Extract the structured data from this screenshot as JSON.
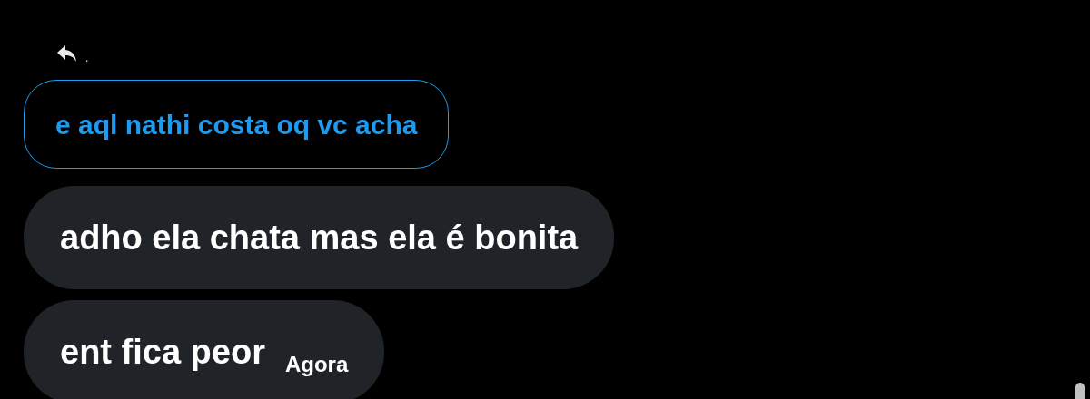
{
  "reply_header": {
    "text": "."
  },
  "quoted_message": {
    "text": "e aql nathi costa oq vc acha"
  },
  "messages": [
    {
      "text": "adho ela chata mas ela é bonita"
    },
    {
      "text": "ent fica peor",
      "time": "Agora"
    }
  ]
}
